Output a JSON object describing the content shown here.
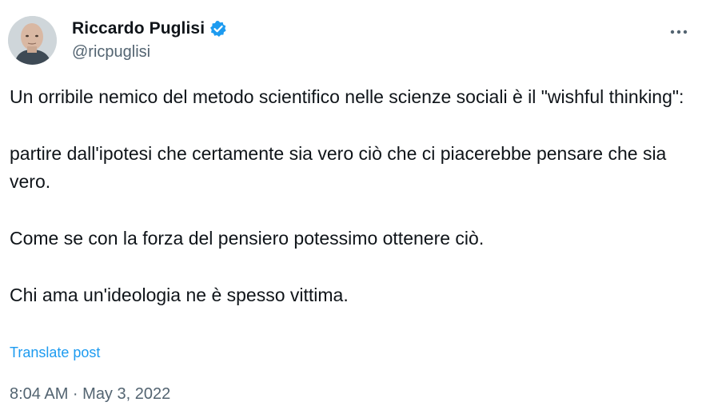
{
  "author": {
    "display_name": "Riccardo Puglisi",
    "handle": "@ricpuglisi",
    "verified": true,
    "verified_color": "#1d9bf0"
  },
  "menu": {
    "icon": "more-horizontal-icon"
  },
  "tweet": {
    "paragraphs": [
      "Un orribile nemico del metodo scientifico nelle scienze sociali è il \"wishful thinking\":",
      "partire dall'ipotesi che certamente sia vero ciò che ci piacerebbe pensare che sia vero.",
      "Come se con la forza del pensiero potessimo ottenere ciò.",
      "Chi ama un'ideologia ne è spesso vittima."
    ],
    "translate_label": "Translate post",
    "timestamp": "8:04 AM · May 3, 2022"
  },
  "colors": {
    "text": "#0f1419",
    "secondary": "#536471",
    "accent": "#1d9bf0"
  }
}
